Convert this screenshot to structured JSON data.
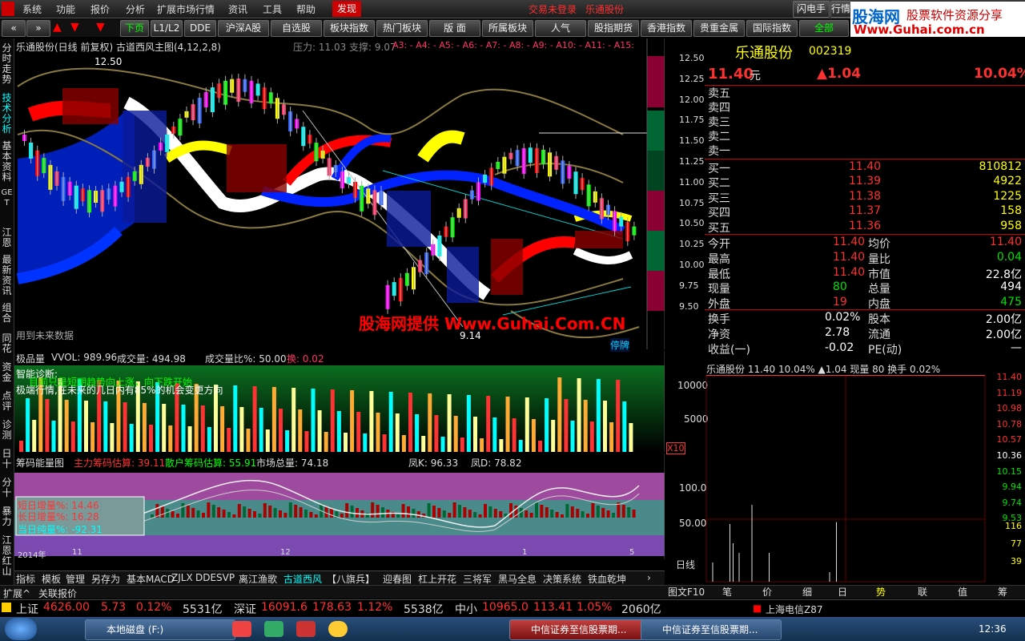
{
  "menu": {
    "items": [
      "系统",
      "功能",
      "报价",
      "分析",
      "扩展市场行情",
      "资讯",
      "工具",
      "帮助",
      "发现"
    ],
    "notice": "交易未登录",
    "stock": "乐通股份",
    "right_btns": [
      "闪电手",
      "行情"
    ]
  },
  "brand": {
    "name": "股海网",
    "tag": "股票软件资源分享",
    "url": "Www.Guhai.com.cn"
  },
  "toolbar": [
    "下页",
    "L1/L2",
    "DDE切",
    "沪深A股",
    "自选股",
    "板块指数",
    "热门板块",
    "版  面",
    "所属板块",
    "人气",
    "股指期货",
    "香港指数",
    "贵重金属",
    "国际指数",
    "全部"
  ],
  "lefttabs": [
    "分时走势",
    "技术分析",
    "基本资料",
    "GET",
    "江恩",
    "最新资讯",
    "组合",
    "同花",
    "资金",
    "点评",
    "诊测",
    "日十",
    "分十",
    "暴力",
    "江恩红山"
  ],
  "main": {
    "title": "乐通股份(日线 前复权) 古道西风主图(4,12,2,8)",
    "pressure": "压力: 11.03 支撑: 9.07",
    "alabels": "A3: - A4: - A5: - A6: - A7: - A8: - A9: - A10: - A11: - A15:",
    "high_mark": "12.50",
    "low_mark": "9.14",
    "future": "用到未来数据",
    "badge": "停牌",
    "watermark": "股海网提供 Www.Guhai.Com.CN",
    "yaxis": [
      "12.50",
      "12.25",
      "12.00",
      "11.75",
      "11.50",
      "11.25",
      "11.00",
      "10.75",
      "10.50",
      "10.25",
      "10.00",
      "9.75",
      "9.50"
    ]
  },
  "vol": {
    "title": "极品量",
    "vvol": "VVOL: 989.96",
    "cjl": "成交量: 494.98",
    "ratio": "成交量比%: 50.00",
    "huan": "换: 0.02",
    "diag_title": "智能诊断:",
    "diag1": "目前只是短期趋势向上涨，向下跌开始",
    "diag2": "极端行情,在未来的几日内有85%的机会变更方向",
    "yaxis": [
      "10000",
      "5000"
    ],
    "x10": "X10"
  },
  "chip": {
    "title": "筹码能量图",
    "main": "主力筹码估算: 39.11",
    "retail": "散户筹码估算: 55.91",
    "market": "市场总量: 74.18",
    "k": "凤K: 96.33",
    "d": "凤D: 78.82",
    "l1": "短日增量%: 14.46",
    "l2": "长日增量%: 16.28",
    "l3": "当日纯量%: -92.31",
    "yaxis": [
      "100.0",
      "50.00"
    ],
    "years": [
      "2014年",
      "11",
      "12",
      "1",
      "5"
    ],
    "bottomline": "日线"
  },
  "bottomtabs": [
    "指标",
    "模板",
    "管理",
    "另存为",
    "基本MACD",
    "ZJLX",
    "DDE",
    "SVP",
    "离江渔歌",
    "古道西风",
    "【八旗兵】",
    "迎春图",
    "杠上开花",
    "三将军",
    "黑马全息",
    "决策系统",
    "铁血乾坤"
  ],
  "bottomtabs2": [
    "扩展^",
    "关联报价"
  ],
  "quote": {
    "name": "乐通股份",
    "code": "002319",
    "price": "11.40",
    "unit": "元",
    "change": "▲1.04",
    "pct": "10.04%",
    "sells": [
      "卖五",
      "卖四",
      "卖三",
      "卖二",
      "卖一"
    ],
    "buys": [
      {
        "label": "买一",
        "price": "11.40",
        "vol": "810812"
      },
      {
        "label": "买二",
        "price": "11.39",
        "vol": "4922"
      },
      {
        "label": "买三",
        "price": "11.38",
        "vol": "1225"
      },
      {
        "label": "买四",
        "price": "11.37",
        "vol": "158"
      },
      {
        "label": "买五",
        "price": "11.36",
        "vol": "958"
      }
    ],
    "stats": [
      {
        "l": "今开",
        "v": "11.40",
        "l2": "均价",
        "v2": "11.40"
      },
      {
        "l": "最高",
        "v": "11.40",
        "l2": "量比",
        "v2": "0.04"
      },
      {
        "l": "最低",
        "v": "11.40",
        "l2": "市值",
        "v2": "22.8亿"
      },
      {
        "l": "现量",
        "v": "80",
        "l2": "总量",
        "v2": "494"
      },
      {
        "l": "外盘",
        "v": "19",
        "l2": "内盘",
        "v2": "475"
      }
    ],
    "stats2": [
      {
        "l": "换手",
        "v": "0.02%",
        "l2": "股本",
        "v2": "2.00亿"
      },
      {
        "l": "净资",
        "v": "2.78",
        "l2": "流通",
        "v2": "2.00亿"
      },
      {
        "l": "收益(一)",
        "v": "-0.02",
        "l2": "PE(动)",
        "v2": "—"
      }
    ],
    "mini_header": "乐通股份 11.40 10.04% ▲1.04 现量 80 换手 0.02%",
    "mini_axis": [
      "11.40",
      "11.19",
      "10.98",
      "10.78",
      "10.57",
      "10.36",
      "10.15",
      "9.94",
      "9.74",
      "9.53",
      "116",
      "77",
      "39"
    ]
  },
  "minitabs": [
    "笔",
    "价",
    "细",
    "日",
    "势",
    "联",
    "值",
    "筹"
  ],
  "minitab_lead": "图文F10",
  "index": [
    {
      "name": "上证",
      "v": "4626.00",
      "c": "5.73",
      "p": "0.12%",
      "amt": "5531亿"
    },
    {
      "name": "深证",
      "v": "16091.6",
      "c": "178.63",
      "p": "1.12%",
      "amt": "5538亿"
    },
    {
      "name": "中小",
      "v": "10965.0",
      "c": "113.41",
      "p": "1.05%",
      "amt": "2060亿"
    }
  ],
  "telecom": "上海电信Z87",
  "taskbar": {
    "items": [
      "本地磁盘 (F:)",
      "中信证券至信股票期...",
      "中信证券至信股票期..."
    ],
    "time": "12:36"
  },
  "colors": {
    "up": "#ff3030",
    "down": "#00e000",
    "accent": "#ff0",
    "bg": "#000"
  }
}
